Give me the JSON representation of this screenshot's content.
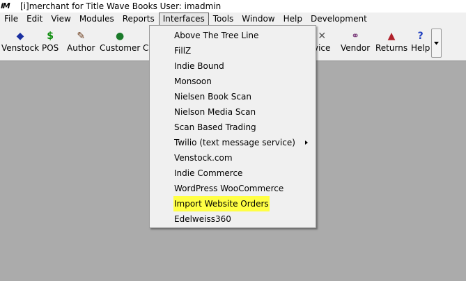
{
  "window": {
    "title": "[i]merchant for Title Wave Books User: imadmin",
    "logo_text": "iM"
  },
  "menubar": {
    "items": [
      "File",
      "Edit",
      "View",
      "Modules",
      "Reports",
      "Interfaces",
      "Tools",
      "Window",
      "Help",
      "Development"
    ],
    "active": "Interfaces"
  },
  "toolbar": {
    "items": [
      {
        "label": "Venstock",
        "icon": "diamond-icon",
        "color": "#1a2fa0"
      },
      {
        "label": "POS",
        "icon": "dollar-icon",
        "color": "#0a8a0a"
      },
      {
        "label": "Author",
        "icon": "author-icon",
        "color": "#6b3b1a"
      },
      {
        "label": "Customer",
        "icon": "globe-icon",
        "color": "#1a7a2a"
      },
      {
        "label": "C",
        "icon": "partial-icon",
        "color": "#444444"
      },
      {
        "label": "vice",
        "icon": "wrench-icon",
        "color": "#555555"
      },
      {
        "label": "Vendor",
        "icon": "vendor-icon",
        "color": "#7a3a7a"
      },
      {
        "label": "Returns",
        "icon": "returns-icon",
        "color": "#b0202a"
      },
      {
        "label": "Help",
        "icon": "help-icon",
        "color": "#2040c0"
      }
    ]
  },
  "interfaces_menu": {
    "items": [
      {
        "label": "Above The Tree Line"
      },
      {
        "label": "FillZ"
      },
      {
        "label": "Indie Bound"
      },
      {
        "label": "Monsoon"
      },
      {
        "label": "Nielsen Book Scan"
      },
      {
        "label": "Nielson Media Scan"
      },
      {
        "label": "Scan Based Trading"
      },
      {
        "label": "Twilio (text message service)",
        "submenu": true
      },
      {
        "label": "Venstock.com"
      },
      {
        "label": "Indie Commerce"
      },
      {
        "label": "WordPress WooCommerce"
      },
      {
        "label": "Import Website Orders",
        "highlighted": true,
        "highlight_color": "#ffff44"
      },
      {
        "label": "Edelweiss360"
      }
    ]
  }
}
